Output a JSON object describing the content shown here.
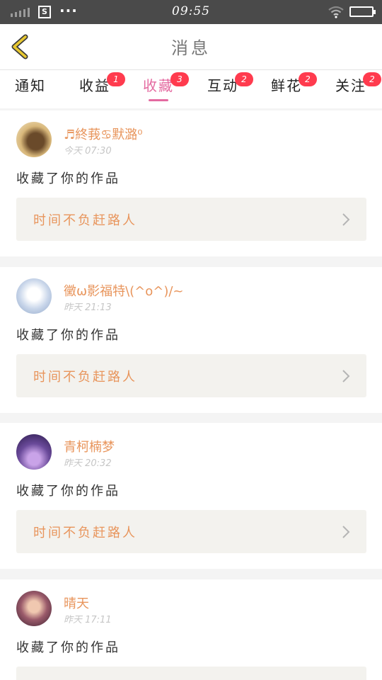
{
  "status_bar": {
    "time": "09:55",
    "signal_icon": "signal-bars-icon",
    "sim_icon_text": "S",
    "more_icon": "more-dots-icon",
    "wifi_icon": "wifi-icon",
    "battery_icon": "battery-icon"
  },
  "header": {
    "title": "消息",
    "back_icon": "back-arrow-icon",
    "accent_color": "#e8c830"
  },
  "tabs": [
    {
      "label": "通知",
      "badge": "",
      "active": false
    },
    {
      "label": "收益",
      "badge": "1",
      "active": false
    },
    {
      "label": "收藏",
      "badge": "3",
      "active": true
    },
    {
      "label": "互动",
      "badge": "2",
      "active": false
    },
    {
      "label": "鲜花",
      "badge": "2",
      "active": false
    },
    {
      "label": "关注",
      "badge": "2",
      "active": false
    }
  ],
  "colors": {
    "active_tab": "#e46aa0",
    "badge": "#ff3b4e",
    "name": "#e8955c",
    "work_title": "#e8955c"
  },
  "messages": [
    {
      "user": "♬終莪♋默潞⁰",
      "time": "今天 07:30",
      "text": "收藏了你的作品",
      "work_title": "时间不负赶路人",
      "avatar_color": "#d8b77a"
    },
    {
      "user": "黴ω影福特\\(^o^)/~",
      "time": "昨天 21:13",
      "text": "收藏了你的作品",
      "work_title": "时间不负赶路人",
      "avatar_color": "#c9d6ea"
    },
    {
      "user": "青柯楠梦",
      "time": "昨天 20:32",
      "text": "收藏了你的作品",
      "work_title": "时间不负赶路人",
      "avatar_color": "#6a4a9a"
    },
    {
      "user": "晴天",
      "time": "昨天 17:11",
      "text": "收藏了你的作品",
      "work_title": "",
      "avatar_color": "#9a5a6a"
    }
  ]
}
